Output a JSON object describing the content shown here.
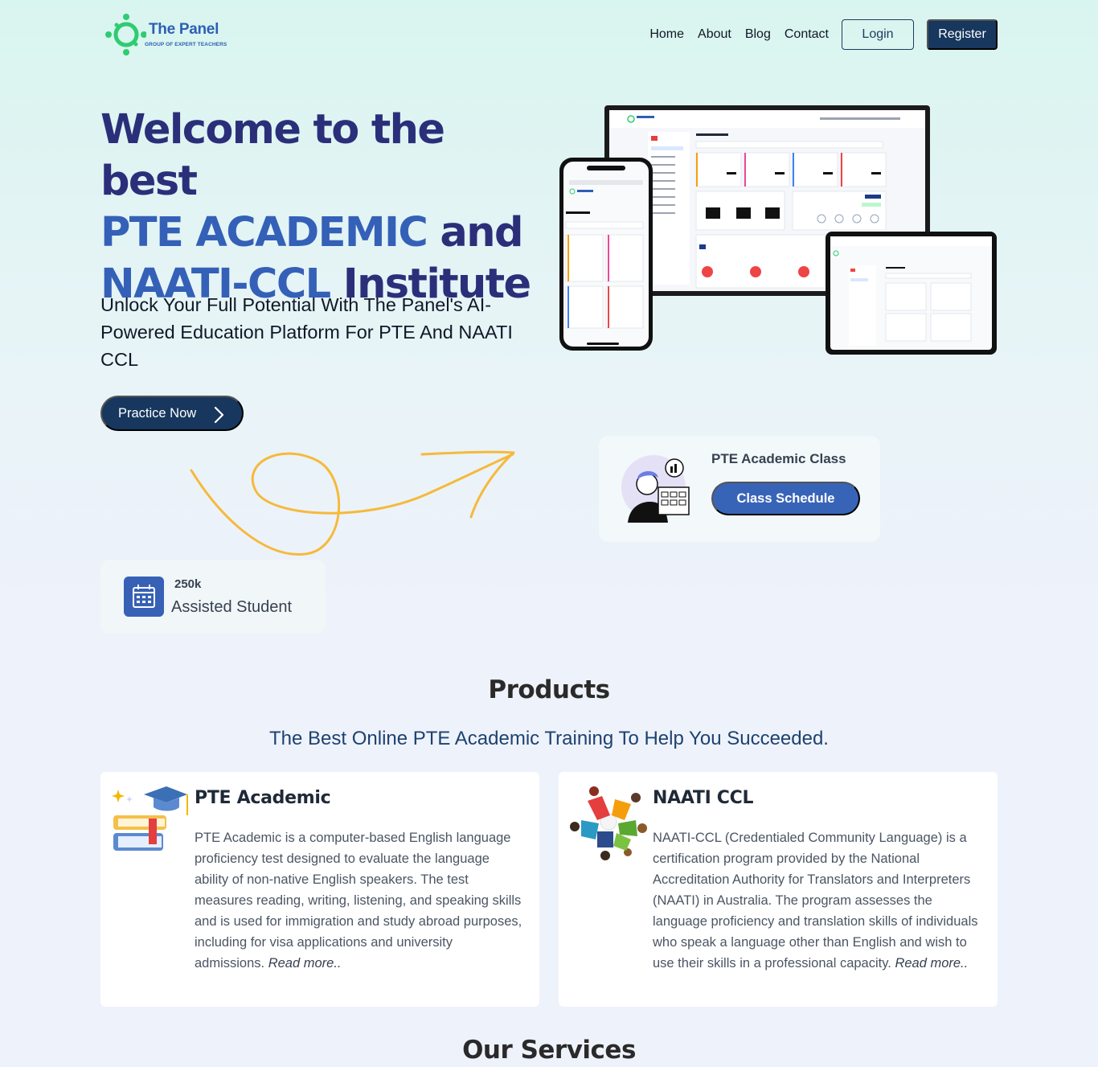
{
  "brand": {
    "title": "The Panel",
    "tagline": "GROUP OF EXPERT TEACHERS",
    "color_primary": "#2d5fb5",
    "color_logo_green": "#2ecc71"
  },
  "nav": {
    "links": [
      "Home",
      "About",
      "Blog",
      "Contact"
    ],
    "login_label": "Login",
    "register_label": "Register"
  },
  "hero": {
    "title_line1": "Welcome to the best",
    "title_accent1": "PTE ACADEMIC",
    "title_mid": "and",
    "title_accent2": "NAATI-CCL",
    "title_end": "Institute",
    "subtitle": "Unlock Your Full Potential With The Panel's AI-Powered Education Platform For PTE And NAATI CCL",
    "cta_label": "Practice Now"
  },
  "class_card": {
    "title": "PTE Academic Class",
    "button_label": "Class Schedule"
  },
  "stat": {
    "value": "250k",
    "label": "Assisted Student",
    "icon": "calendar-icon"
  },
  "products": {
    "title": "Products",
    "subtitle": "The Best Online PTE Academic Training To Help You Succeeded.",
    "items": [
      {
        "name": "PTE Academic",
        "description": "PTE Academic is a computer-based English language proficiency test designed to evaluate the language ability of non-native English speakers. The test measures reading, writing, listening, and speaking skills and is used for immigration and study abroad purposes, including for visa applications and university admissions.",
        "read_more": "Read more..",
        "icon": "books-graduation-cap-icon"
      },
      {
        "name": "NAATI CCL",
        "description": "NAATI-CCL (Credentialed Community Language) is a certification program provided by the National Accreditation Authority for Translators and Interpreters (NAATI) in Australia. The program assesses the language proficiency and translation skills of individuals who speak a language other than English and wish to use their skills in a professional capacity.",
        "read_more": "Read more..",
        "icon": "community-people-icon"
      }
    ]
  },
  "services": {
    "title": "Our Services"
  },
  "colors": {
    "navy": "#17375e",
    "blue": "#3864b8",
    "heading_dark": "#2b2f7a",
    "arrow_yellow": "#f6b93b"
  }
}
